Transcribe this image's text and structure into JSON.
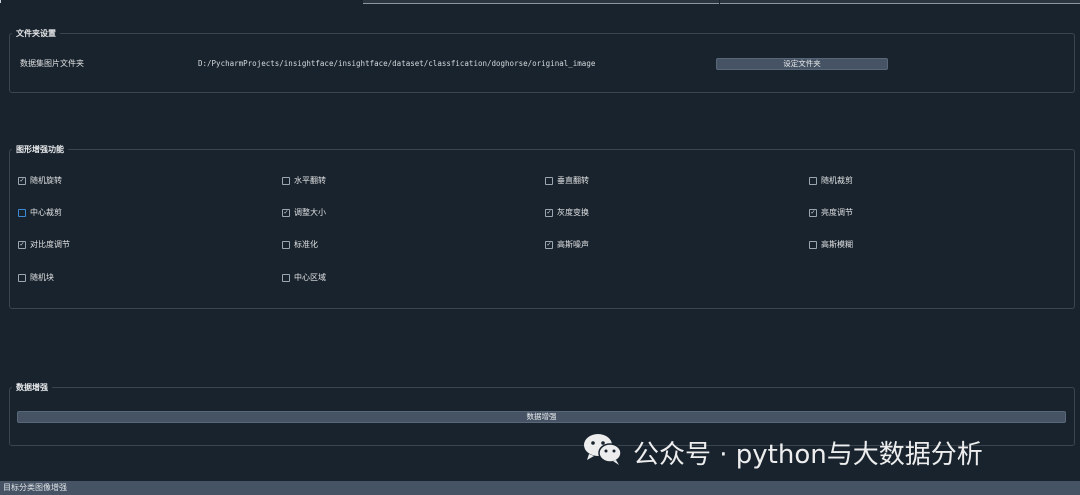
{
  "folder_section": {
    "title": "文件夹设置",
    "label": "数据集图片文件夹",
    "path": "D:/PycharmProjects/insightface/insightface/dataset/classfication/doghorse/original_image",
    "button": "设定文件夹"
  },
  "augment_section": {
    "title": "图形增强功能",
    "options": [
      {
        "label": "随机旋转",
        "checked": true
      },
      {
        "label": "水平翻转",
        "checked": false
      },
      {
        "label": "垂直翻转",
        "checked": false
      },
      {
        "label": "随机裁剪",
        "checked": false
      },
      {
        "label": "中心裁剪",
        "checked": false
      },
      {
        "label": "调整大小",
        "checked": true
      },
      {
        "label": "灰度变换",
        "checked": true
      },
      {
        "label": "亮度调节",
        "checked": true
      },
      {
        "label": "对比度调节",
        "checked": true
      },
      {
        "label": "标准化",
        "checked": false
      },
      {
        "label": "高斯噪声",
        "checked": true
      },
      {
        "label": "高斯模糊",
        "checked": false
      },
      {
        "label": "随机块",
        "checked": false
      },
      {
        "label": "中心区域",
        "checked": false
      }
    ]
  },
  "data_section": {
    "title": "数据增强",
    "button": "数据增强"
  },
  "status_bar": {
    "text": "目标分类图像增强"
  },
  "watermark": {
    "text": "公众号 · python与大数据分析",
    "icon": "wechat-icon"
  },
  "colors": {
    "background": "#19232d",
    "button": "#455364",
    "border": "#3a4550",
    "focus": "#3b8bd6"
  }
}
